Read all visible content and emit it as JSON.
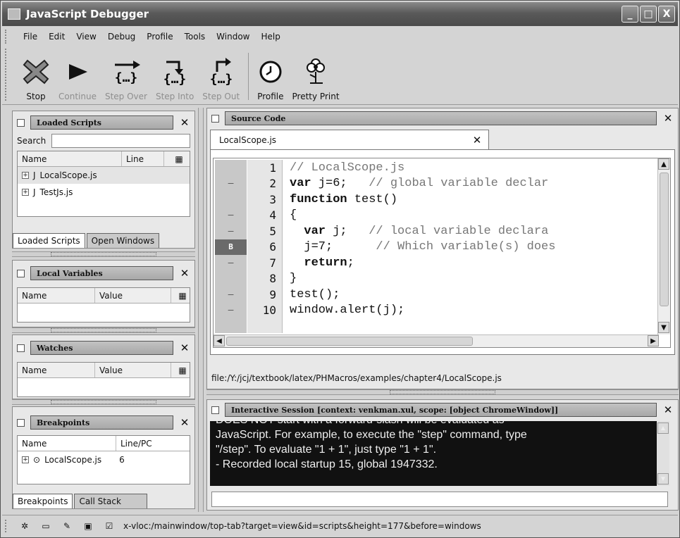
{
  "window": {
    "title": "JavaScript Debugger",
    "controls": [
      "_",
      "□",
      "X"
    ]
  },
  "menu": [
    "File",
    "Edit",
    "View",
    "Debug",
    "Profile",
    "Tools",
    "Window",
    "Help"
  ],
  "toolbar": {
    "stop": "Stop",
    "continue": "Continue",
    "step_over": "Step Over",
    "step_into": "Step Into",
    "step_out": "Step Out",
    "profile": "Profile",
    "pretty_print": "Pretty Print"
  },
  "loaded_scripts": {
    "title": "Loaded Scripts",
    "search_label": "Search",
    "search_value": "",
    "columns": [
      "Name",
      "Line"
    ],
    "rows": [
      {
        "prefix": "J",
        "name": "LocalScope.js"
      },
      {
        "prefix": "J",
        "name": "TestJs.js"
      }
    ],
    "tabs": [
      "Loaded Scripts",
      "Open Windows"
    ]
  },
  "local_variables": {
    "title": "Local Variables",
    "columns": [
      "Name",
      "Value"
    ]
  },
  "watches": {
    "title": "Watches",
    "columns": [
      "Name",
      "Value"
    ]
  },
  "breakpoints": {
    "title": "Breakpoints",
    "columns": [
      "Name",
      "Line/PC"
    ],
    "rows": [
      {
        "name": "LocalScope.js",
        "line": "6"
      }
    ],
    "tabs": [
      "Breakpoints",
      "Call Stack"
    ]
  },
  "source": {
    "title": "Source Code",
    "tab": "LocalScope.js",
    "gutter": [
      "",
      "–",
      "",
      "–",
      "–",
      "B",
      "–",
      "",
      "–",
      "–"
    ],
    "line_numbers": [
      "1",
      "2",
      "3",
      "4",
      "5",
      "6",
      "7",
      "8",
      "9",
      "10"
    ],
    "lines": [
      {
        "kw": "",
        "text": "",
        "comment": "// LocalScope.js"
      },
      {
        "kw": "var",
        "text": " j=6;   ",
        "comment": "// global variable declar"
      },
      {
        "kw": "function",
        "text": " test()",
        "comment": ""
      },
      {
        "kw": "",
        "text": "{",
        "comment": ""
      },
      {
        "kw": "  var",
        "text": " j;   ",
        "comment": "// local variable declara"
      },
      {
        "kw": "",
        "text": "  j=7;      ",
        "comment": "// Which variable(s) does"
      },
      {
        "kw": "  return",
        "text": ";",
        "comment": ""
      },
      {
        "kw": "",
        "text": "}",
        "comment": ""
      },
      {
        "kw": "",
        "text": "test();",
        "comment": ""
      },
      {
        "kw": "",
        "text": "window.alert(j);",
        "comment": ""
      }
    ],
    "path": "file:/Y:/jcj/textbook/latex/PHMacros/examples/chapter4/LocalScope.js"
  },
  "interactive": {
    "title": "Interactive Session [context: venkman.xul, scope: [object ChromeWindow]]",
    "lines": [
      "DOES NOT start with a forward-slash will be evaluated as",
      "JavaScript.  For example, to execute the \"step\" command, type",
      "\"/step\".  To evaluate \"1 + 1\", just type \"1 + 1\".",
      "- Recorded local startup 15, global 1947332."
    ],
    "input_value": ""
  },
  "status": {
    "text": "x-vloc:/mainwindow/top-tab?target=view&id=scripts&height=177&before=windows"
  }
}
